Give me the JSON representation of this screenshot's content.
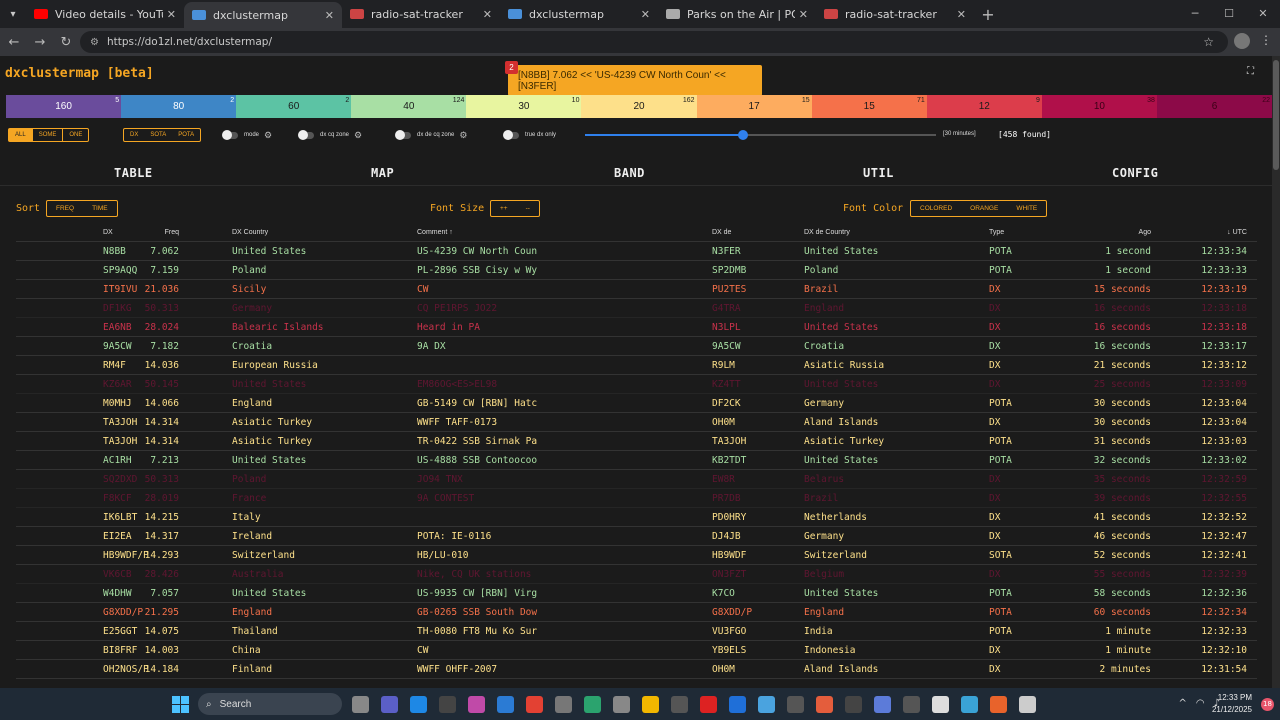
{
  "browser": {
    "tabs": [
      {
        "label": "Video details - YouTube Studio",
        "fav": "#ff0000",
        "active": false
      },
      {
        "label": "dxclustermap",
        "fav": "#4a90d9",
        "active": true
      },
      {
        "label": "radio-sat-tracker",
        "fav": "#c44",
        "active": false
      },
      {
        "label": "dxclustermap",
        "fav": "#4a90d9",
        "active": false
      },
      {
        "label": "Parks on the Air | POTA",
        "fav": "#aaa",
        "active": false
      },
      {
        "label": "radio-sat-tracker",
        "fav": "#c44",
        "active": false
      }
    ],
    "url": "https://do1zl.net/dxclustermap/"
  },
  "app": {
    "title": "dxclustermap [beta]",
    "toast": {
      "badge": "2",
      "text": "[N8BB] 7.062 << 'US-4239 CW North Coun' << [N3FER]"
    },
    "bands": [
      {
        "label": "160",
        "count": "5",
        "bg": "#6a4c9c",
        "fg": "#ffffff"
      },
      {
        "label": "80",
        "count": "2",
        "bg": "#3e86c6",
        "fg": "#ffffff"
      },
      {
        "label": "60",
        "count": "2",
        "bg": "#5cc3a4",
        "fg": "#1b1b1b"
      },
      {
        "label": "40",
        "count": "124",
        "bg": "#a8dfa4",
        "fg": "#1b1b1b"
      },
      {
        "label": "30",
        "count": "10",
        "bg": "#e8f5a0",
        "fg": "#1b1b1b"
      },
      {
        "label": "20",
        "count": "162",
        "bg": "#fde08a",
        "fg": "#1b1b1b"
      },
      {
        "label": "17",
        "count": "15",
        "bg": "#fdac5f",
        "fg": "#1b1b1b"
      },
      {
        "label": "15",
        "count": "71",
        "bg": "#f5714a",
        "fg": "#1b1b1b"
      },
      {
        "label": "12",
        "count": "9",
        "bg": "#dc3d4b",
        "fg": "#1b1b1b"
      },
      {
        "label": "10",
        "count": "38",
        "bg": "#b0104a",
        "fg": "#3a0016"
      },
      {
        "label": "6",
        "count": "22",
        "bg": "#8c0a48",
        "fg": "#3a0016"
      }
    ],
    "filters": {
      "scope": [
        "ALL",
        "SOME",
        "ONE"
      ],
      "spot_types": [
        "DX",
        "SOTA",
        "POTA"
      ],
      "mode_label": "mode",
      "cq_zone_label": "dx cq zone",
      "de_cq_zone_label": "dx de cq zone",
      "true_dx_label": "true dx only",
      "range_label": "[30 minutes]",
      "range_fraction": 0.45,
      "found": "[458 found]"
    },
    "nav": [
      "TABLE",
      "MAP",
      "BAND",
      "UTIL",
      "CONFIG"
    ],
    "sort": {
      "label": "Sort",
      "options": [
        "FREQ",
        "TIME"
      ]
    },
    "font_size": {
      "label": "Font Size",
      "options": [
        "++",
        "--"
      ]
    },
    "font_color": {
      "label": "Font Color",
      "options": [
        "COLORED",
        "ORANGE",
        "WHITE"
      ]
    },
    "columns": {
      "freq": "Freq",
      "dx": "DX",
      "country": "DX Country",
      "comment": "Comment ↑",
      "spotter": "DX de",
      "spotter_country": "DX de Country",
      "type": "Type",
      "ago": "Ago",
      "utc": "↓ UTC"
    },
    "rows": [
      {
        "freq": "7.062",
        "dx": "N8BB",
        "country": "United States",
        "comment": "US-4239 CW North Coun",
        "spotter": "N3FER",
        "spotter_country": "United States",
        "type": "POTA",
        "ago": "1 second",
        "utc": "12:33:34",
        "color": "#a8dfa4",
        "dim": false
      },
      {
        "freq": "7.159",
        "dx": "SP9AQQ",
        "country": "Poland",
        "comment": "PL-2896 SSB Cisy w Wy",
        "spotter": "SP2DMB",
        "spotter_country": "Poland",
        "type": "POTA",
        "ago": "1 second",
        "utc": "12:33:33",
        "color": "#a8dfa4",
        "dim": false
      },
      {
        "freq": "21.036",
        "dx": "IT9IVU",
        "country": "Sicily",
        "comment": "CW",
        "spotter": "PU2TES",
        "spotter_country": "Brazil",
        "type": "DX",
        "ago": "15 seconds",
        "utc": "12:33:19",
        "color": "#f5714a",
        "dim": false
      },
      {
        "freq": "50.313",
        "dx": "DF1KG",
        "country": "Germany",
        "comment": "CQ PE1RPS JO22",
        "spotter": "G4TRA",
        "spotter_country": "England",
        "type": "DX",
        "ago": "16 seconds",
        "utc": "12:33:18",
        "color": "#b0104a",
        "dim": true
      },
      {
        "freq": "28.024",
        "dx": "EA6NB",
        "country": "Balearic Islands",
        "comment": "Heard in PA",
        "spotter": "N3LPL",
        "spotter_country": "United States",
        "type": "DX",
        "ago": "16 seconds",
        "utc": "12:33:18",
        "color": "#c8324b",
        "dim": false
      },
      {
        "freq": "7.182",
        "dx": "9A5CW",
        "country": "Croatia",
        "comment": "9A DX",
        "spotter": "9A5CW",
        "spotter_country": "Croatia",
        "type": "DX",
        "ago": "16 seconds",
        "utc": "12:33:17",
        "color": "#a8dfa4",
        "dim": false
      },
      {
        "freq": "14.036",
        "dx": "RM4F",
        "country": "European Russia",
        "comment": "",
        "spotter": "R9LM",
        "spotter_country": "Asiatic Russia",
        "type": "DX",
        "ago": "21 seconds",
        "utc": "12:33:12",
        "color": "#fde08a",
        "dim": false
      },
      {
        "freq": "50.145",
        "dx": "KZ6AR",
        "country": "United States",
        "comment": "EM86OG<ES>EL98",
        "spotter": "KZ4TT",
        "spotter_country": "United States",
        "type": "DX",
        "ago": "25 seconds",
        "utc": "12:33:09",
        "color": "#b0104a",
        "dim": true
      },
      {
        "freq": "14.066",
        "dx": "M0MHJ",
        "country": "England",
        "comment": "GB-5149 CW [RBN] Hatc",
        "spotter": "DF2CK",
        "spotter_country": "Germany",
        "type": "POTA",
        "ago": "30 seconds",
        "utc": "12:33:04",
        "color": "#fde08a",
        "dim": false
      },
      {
        "freq": "14.314",
        "dx": "TA3JOH",
        "country": "Asiatic Turkey",
        "comment": "WWFF TAFF-0173",
        "spotter": "OH0M",
        "spotter_country": "Aland Islands",
        "type": "DX",
        "ago": "30 seconds",
        "utc": "12:33:04",
        "color": "#fde08a",
        "dim": false
      },
      {
        "freq": "14.314",
        "dx": "TA3JOH",
        "country": "Asiatic Turkey",
        "comment": "TR-0422 SSB Sirnak Pa",
        "spotter": "TA3JOH",
        "spotter_country": "Asiatic Turkey",
        "type": "POTA",
        "ago": "31 seconds",
        "utc": "12:33:03",
        "color": "#fde08a",
        "dim": false
      },
      {
        "freq": "7.213",
        "dx": "AC1RH",
        "country": "United States",
        "comment": "US-4888 SSB Contoocoo",
        "spotter": "KB2TDT",
        "spotter_country": "United States",
        "type": "POTA",
        "ago": "32 seconds",
        "utc": "12:33:02",
        "color": "#a8dfa4",
        "dim": false
      },
      {
        "freq": "50.313",
        "dx": "SQ2DXD",
        "country": "Poland",
        "comment": "JO94 TNX",
        "spotter": "EW8R",
        "spotter_country": "Belarus",
        "type": "DX",
        "ago": "35 seconds",
        "utc": "12:32:59",
        "color": "#b0104a",
        "dim": true
      },
      {
        "freq": "28.019",
        "dx": "F8KCF",
        "country": "France",
        "comment": "9A CONTEST",
        "spotter": "PR7DB",
        "spotter_country": "Brazil",
        "type": "DX",
        "ago": "39 seconds",
        "utc": "12:32:55",
        "color": "#b0104a",
        "dim": true
      },
      {
        "freq": "14.215",
        "dx": "IK6LBT",
        "country": "Italy",
        "comment": "",
        "spotter": "PD0HRY",
        "spotter_country": "Netherlands",
        "type": "DX",
        "ago": "41 seconds",
        "utc": "12:32:52",
        "color": "#fde08a",
        "dim": false
      },
      {
        "freq": "14.317",
        "dx": "EI2EA",
        "country": "Ireland",
        "comment": "POTA: IE-0116",
        "spotter": "DJ4JB",
        "spotter_country": "Germany",
        "type": "DX",
        "ago": "46 seconds",
        "utc": "12:32:47",
        "color": "#fde08a",
        "dim": false
      },
      {
        "freq": "14.293",
        "dx": "HB9WDF/P",
        "country": "Switzerland",
        "comment": "HB/LU-010",
        "spotter": "HB9WDF",
        "spotter_country": "Switzerland",
        "type": "SOTA",
        "ago": "52 seconds",
        "utc": "12:32:41",
        "color": "#fde08a",
        "dim": false
      },
      {
        "freq": "28.426",
        "dx": "VK6CB",
        "country": "Australia",
        "comment": "Nike, CQ UK stations",
        "spotter": "ON3FZT",
        "spotter_country": "Belgium",
        "type": "DX",
        "ago": "55 seconds",
        "utc": "12:32:39",
        "color": "#b0104a",
        "dim": true
      },
      {
        "freq": "7.057",
        "dx": "W4DHW",
        "country": "United States",
        "comment": "US-9935 CW [RBN] Virg",
        "spotter": "K7CO",
        "spotter_country": "United States",
        "type": "POTA",
        "ago": "58 seconds",
        "utc": "12:32:36",
        "color": "#a8dfa4",
        "dim": false
      },
      {
        "freq": "21.295",
        "dx": "G8XDD/P",
        "country": "England",
        "comment": "GB-0265 SSB South Dow",
        "spotter": "G8XDD/P",
        "spotter_country": "England",
        "type": "POTA",
        "ago": "60 seconds",
        "utc": "12:32:34",
        "color": "#f5714a",
        "dim": false
      },
      {
        "freq": "14.075",
        "dx": "E25GGT",
        "country": "Thailand",
        "comment": "TH-0080 FT8 Mu Ko Sur",
        "spotter": "VU3FGO",
        "spotter_country": "India",
        "type": "POTA",
        "ago": "1 minute",
        "utc": "12:32:33",
        "color": "#fde08a",
        "dim": false
      },
      {
        "freq": "14.003",
        "dx": "BI8FRF",
        "country": "China",
        "comment": "CW",
        "spotter": "YB9ELS",
        "spotter_country": "Indonesia",
        "type": "DX",
        "ago": "1 minute",
        "utc": "12:32:10",
        "color": "#fde08a",
        "dim": false
      },
      {
        "freq": "14.184",
        "dx": "OH2NOS/P",
        "country": "Finland",
        "comment": "WWFF OHFF-2007",
        "spotter": "OH0M",
        "spotter_country": "Aland Islands",
        "type": "DX",
        "ago": "2 minutes",
        "utc": "12:31:54",
        "color": "#fde08a",
        "dim": false
      }
    ]
  },
  "taskbar": {
    "search": "Search",
    "time": "12:33 PM",
    "date": "21/12/2025",
    "notifications": "18"
  }
}
